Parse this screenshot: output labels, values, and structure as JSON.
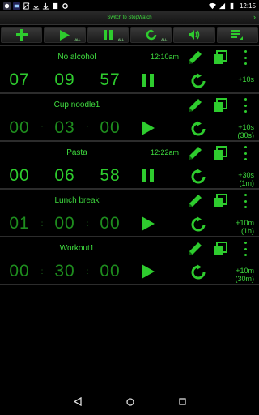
{
  "status_bar": {
    "time": "12:15"
  },
  "switch_bar": {
    "label": "Switch to StopWatch",
    "arrow": "›"
  },
  "toolbar": {
    "add": {
      "icon": "plus-icon"
    },
    "play_all": {
      "icon": "play-icon",
      "sub": "ALL"
    },
    "pause_all": {
      "icon": "pause-icon",
      "sub": "ALL"
    },
    "reset_all": {
      "icon": "reset-icon",
      "sub": "ALL"
    },
    "volume": {
      "icon": "volume-icon"
    },
    "sort": {
      "icon": "sort-icon"
    }
  },
  "timers": [
    {
      "name": "No alcohol",
      "alarm": "12:10am",
      "h": "07",
      "m": "09",
      "s": "57",
      "running": true,
      "add": [
        "+10s"
      ]
    },
    {
      "name": "Cup noodle1",
      "alarm": "",
      "h": "00",
      "m": "03",
      "s": "00",
      "running": false,
      "add": [
        "+10s",
        "(30s)"
      ]
    },
    {
      "name": "Pasta",
      "alarm": "12:22am",
      "h": "00",
      "m": "06",
      "s": "58",
      "running": true,
      "add": [
        "+30s",
        "(1m)"
      ]
    },
    {
      "name": "Lunch break",
      "alarm": "",
      "h": "01",
      "m": "00",
      "s": "00",
      "running": false,
      "add": [
        "+10m",
        "(1h)"
      ]
    },
    {
      "name": "Workout1",
      "alarm": "",
      "h": "00",
      "m": "30",
      "s": "00",
      "running": false,
      "add": [
        "+10m",
        "(30m)"
      ]
    }
  ],
  "colors": {
    "accent": "#2ecc2e",
    "dim": "#1e8d1e",
    "bg": "#000000"
  }
}
